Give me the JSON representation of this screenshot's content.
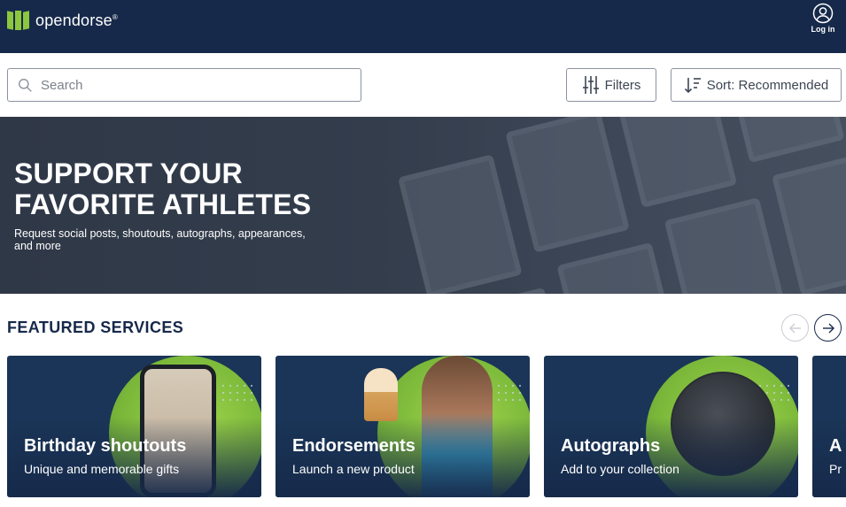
{
  "header": {
    "logo_text": "opendorse",
    "logo_trademark": "®",
    "login_label": "Log in",
    "brand_color": "#8dc63f",
    "nav_color": "#16294a"
  },
  "search": {
    "placeholder": "Search",
    "value": ""
  },
  "toolbar": {
    "filters_label": "Filters",
    "sort_label": "Sort: Recommended"
  },
  "hero": {
    "title_line1": "SUPPORT YOUR",
    "title_line2": "FAVORITE ATHLETES",
    "subtitle": "Request social posts, shoutouts, autographs, appearances, and more"
  },
  "featured": {
    "title": "FEATURED SERVICES",
    "cards": [
      {
        "title": "Birthday shoutouts",
        "subtitle": "Unique and memorable gifts"
      },
      {
        "title": "Endorsements",
        "subtitle": "Launch a new product"
      },
      {
        "title": "Autographs",
        "subtitle": "Add to your collection"
      },
      {
        "title": "A",
        "subtitle": "Pr"
      }
    ]
  },
  "icons": {
    "logo": "opendorse-logo-mark",
    "login": "user-circle-icon",
    "search": "search-icon",
    "filters": "sliders-icon",
    "sort": "sort-icon",
    "prev": "arrow-left-icon",
    "next": "arrow-right-icon"
  }
}
